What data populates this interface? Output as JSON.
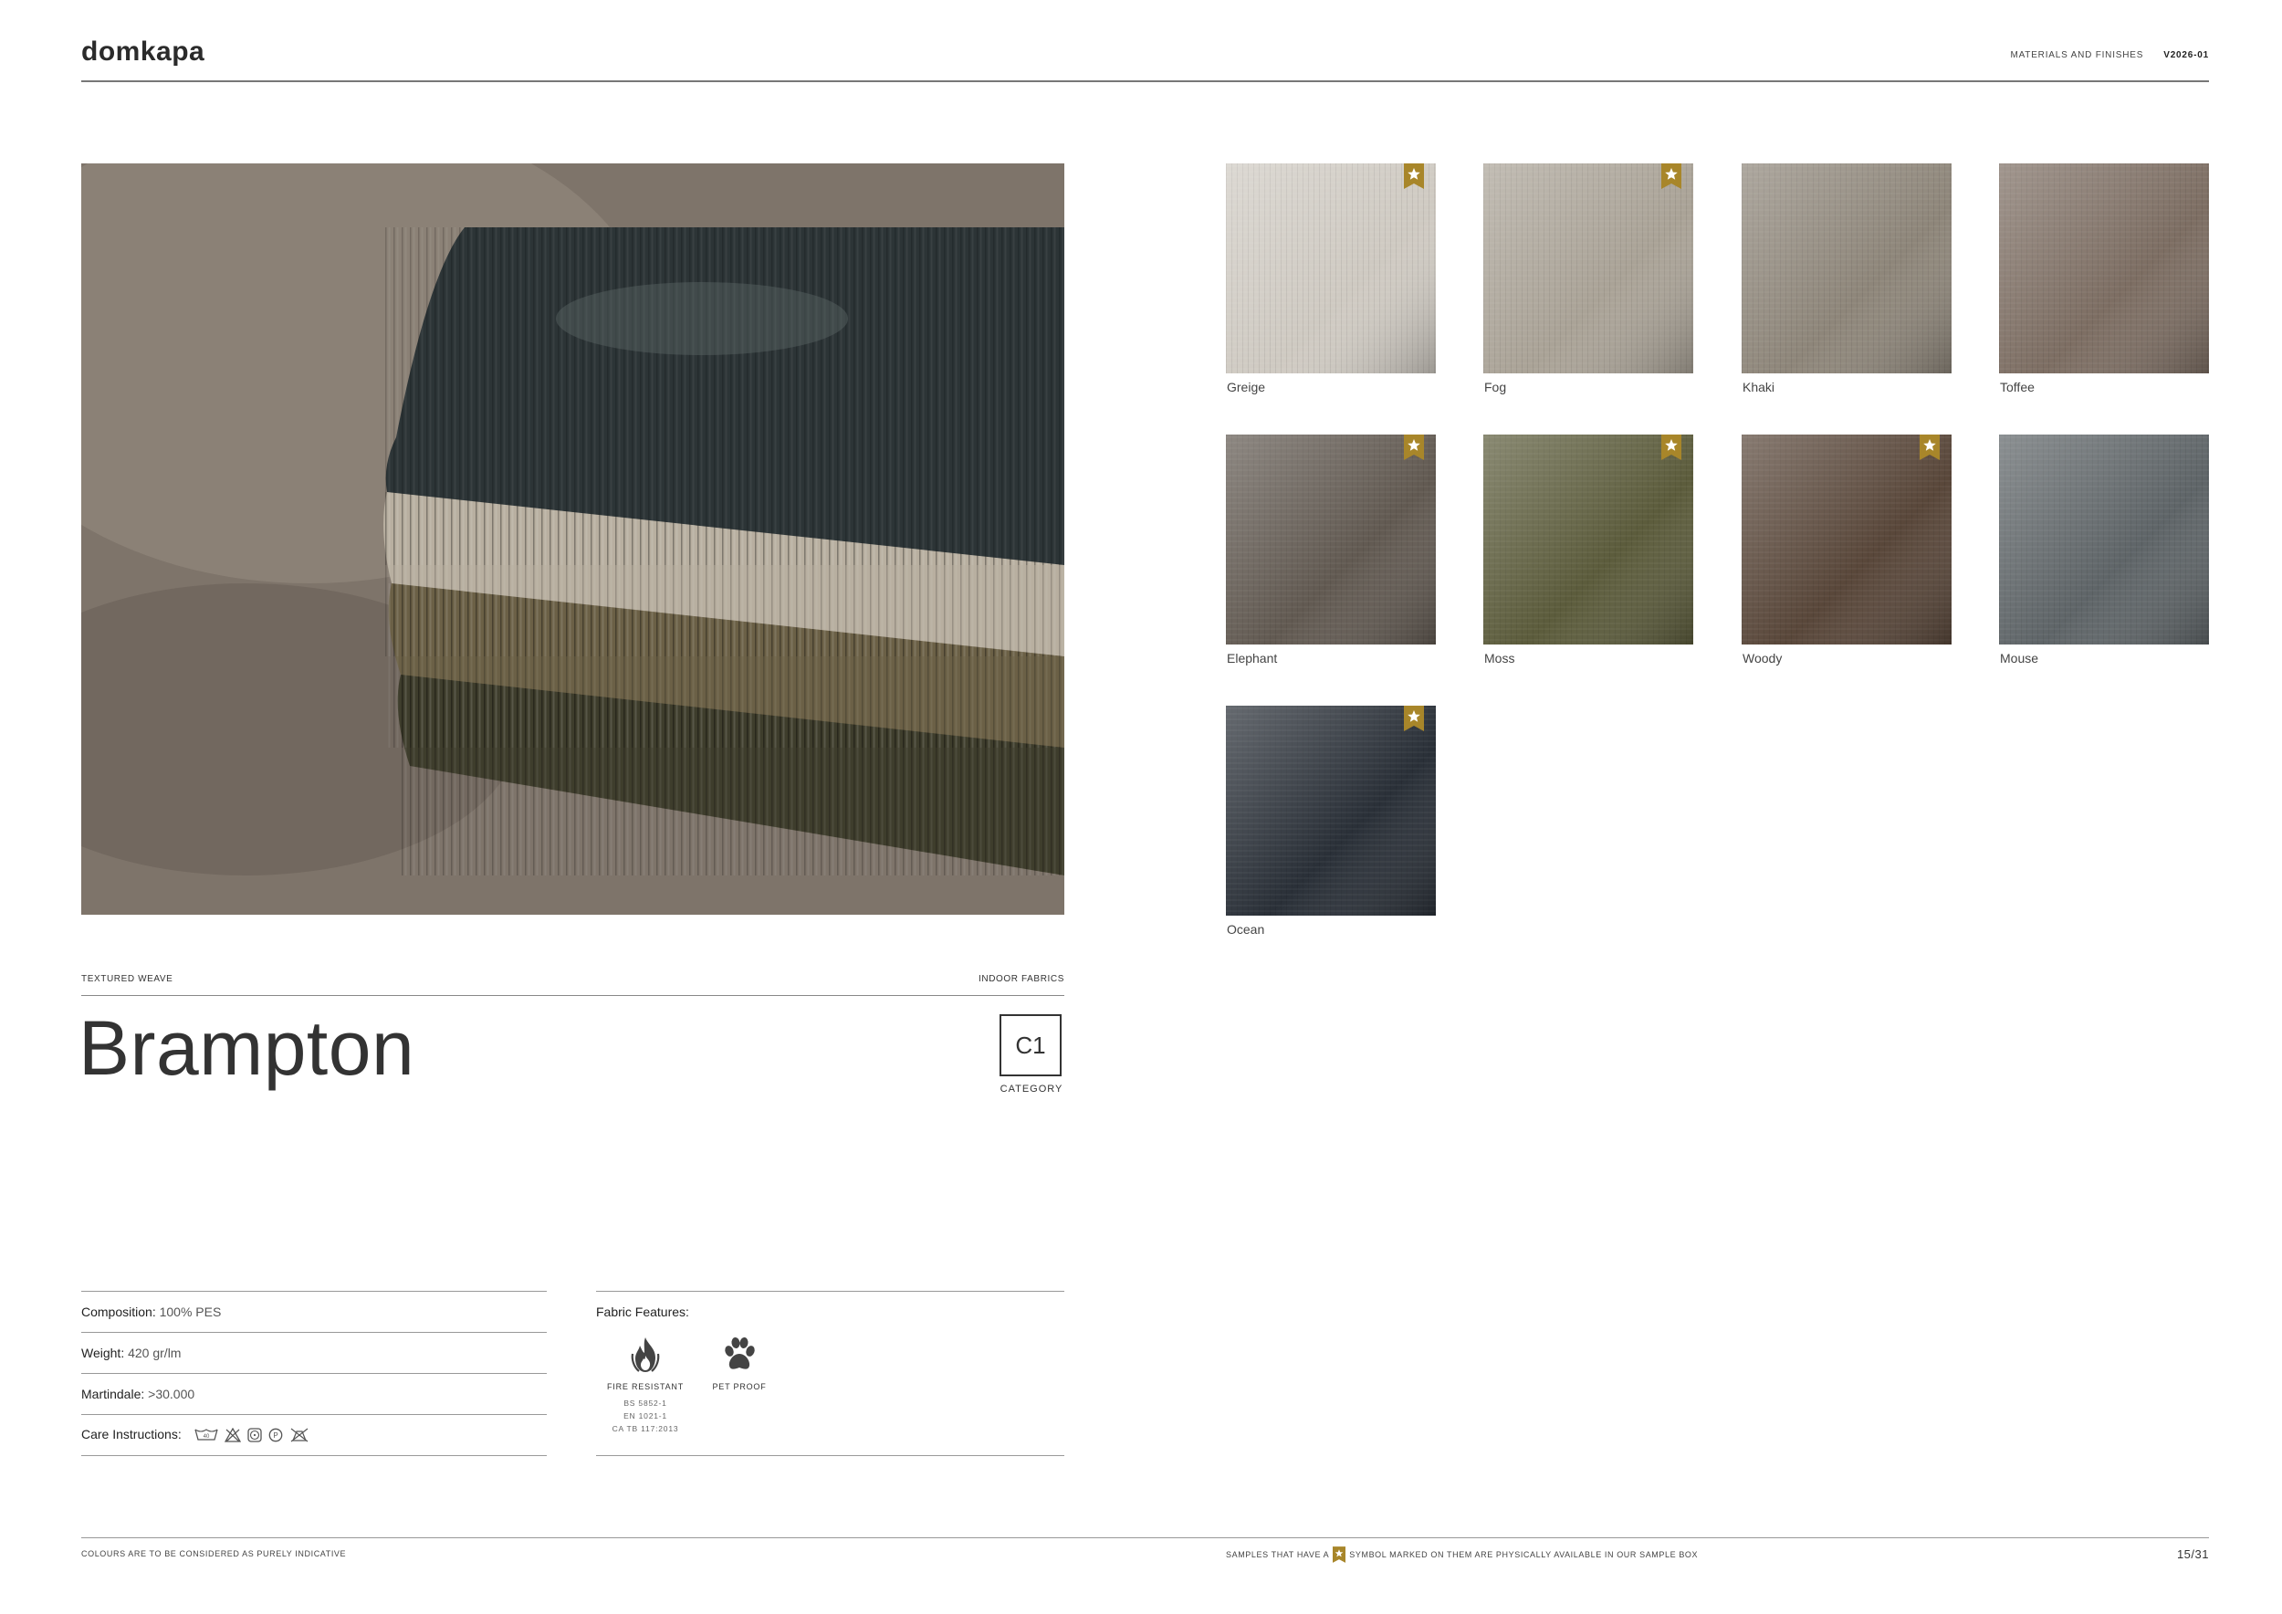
{
  "header": {
    "brand": "domkapa",
    "section": "MATERIALS AND FINISHES",
    "version": "V2026-01"
  },
  "product": {
    "type_label": "TEXTURED WEAVE",
    "line_label": "INDOOR FABRICS",
    "name": "Brampton",
    "category_code": "C1",
    "category_label": "CATEGORY"
  },
  "specs": {
    "composition_label": "Composition:",
    "composition_value": "100% PES",
    "weight_label": "Weight:",
    "weight_value": "420 gr/lm",
    "martindale_label": "Martindale:",
    "martindale_value": ">30.000",
    "care_label": "Care Instructions:",
    "care_icons": [
      "hand-wash-icon",
      "no-bleach-icon",
      "tumble-dry-low-icon",
      "dry-clean-p-icon",
      "no-tumble-dry-icon"
    ]
  },
  "features": {
    "title": "Fabric Features:",
    "items": [
      {
        "icon": "flame-icon",
        "name": "FIRE RESISTANT",
        "norms": [
          "BS 5852-1",
          "EN 1021-1",
          "CA TB 117:2013"
        ]
      },
      {
        "icon": "paw-icon",
        "name": "PET PROOF",
        "norms": []
      }
    ]
  },
  "swatches": [
    {
      "name": "Greige",
      "color": "#cfcac2",
      "starred": true
    },
    {
      "name": "Fog",
      "color": "#aaa397",
      "starred": true
    },
    {
      "name": "Khaki",
      "color": "#8e867a",
      "starred": false
    },
    {
      "name": "Toffee",
      "color": "#7d6e63",
      "starred": false
    },
    {
      "name": "Elephant",
      "color": "#625a52",
      "starred": true
    },
    {
      "name": "Moss",
      "color": "#5c5c3c",
      "starred": true
    },
    {
      "name": "Woody",
      "color": "#59473a",
      "starred": true
    },
    {
      "name": "Mouse",
      "color": "#5f6568",
      "starred": false
    },
    {
      "name": "Ocean",
      "color": "#2a3038",
      "starred": true
    }
  ],
  "footer": {
    "disclaimer": "COLOURS ARE TO BE CONSIDERED AS PURELY INDICATIVE",
    "samples_before": "SAMPLES THAT HAVE A",
    "samples_after": "SYMBOL MARKED ON THEM ARE PHYSICALLY AVAILABLE IN OUR SAMPLE BOX",
    "page": "15/31"
  },
  "colors": {
    "badge_gold": "#a8862a",
    "text_dark": "#333333"
  }
}
